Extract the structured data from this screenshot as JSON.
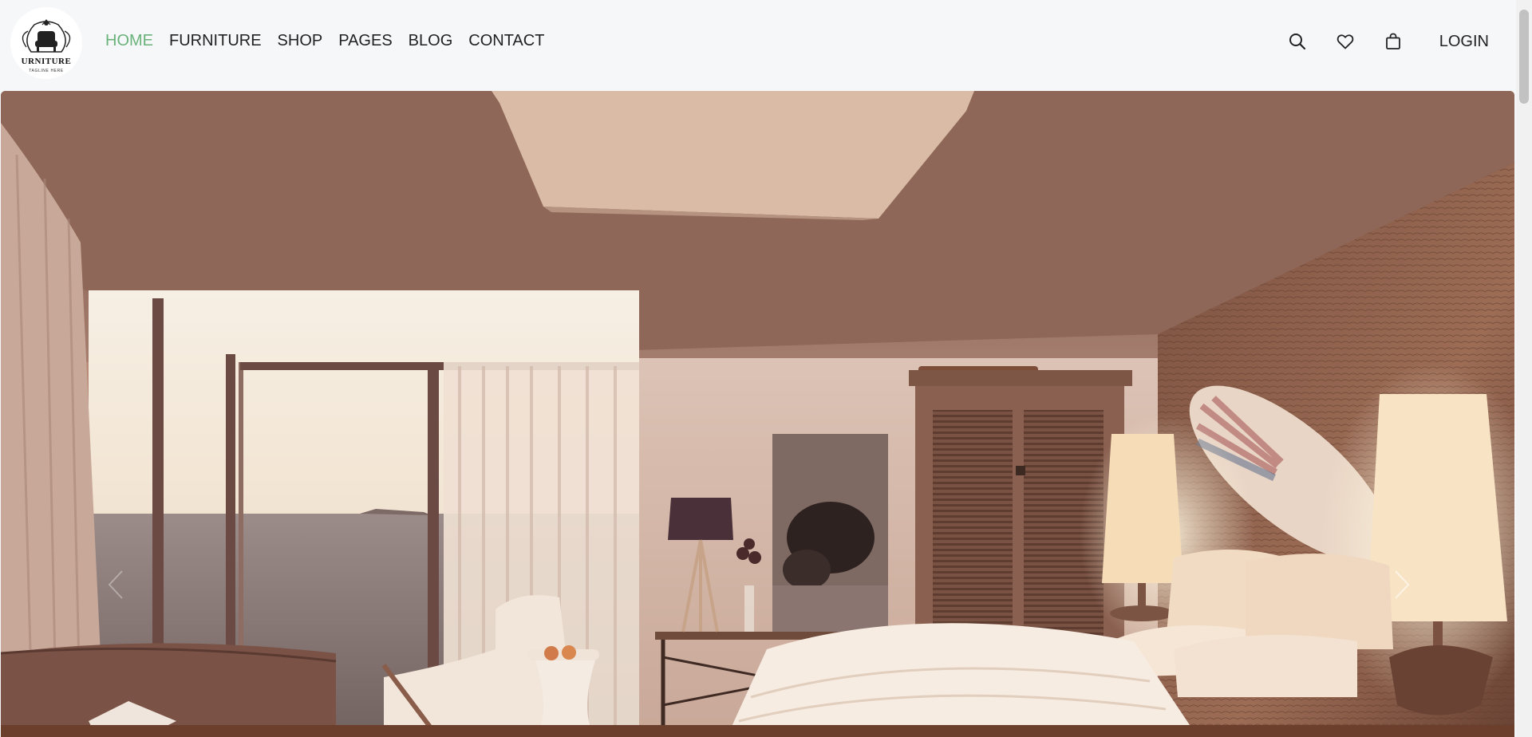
{
  "logo": {
    "text": "URNITURE",
    "tagline": "TAGLINE HERE"
  },
  "nav": {
    "items": [
      {
        "label": "HOME",
        "active": true
      },
      {
        "label": "FURNITURE",
        "active": false
      },
      {
        "label": "SHOP",
        "active": false
      },
      {
        "label": "PAGES",
        "active": false
      },
      {
        "label": "BLOG",
        "active": false
      },
      {
        "label": "CONTACT",
        "active": false
      }
    ]
  },
  "actions": {
    "search_icon": "search-icon",
    "wishlist_icon": "heart-icon",
    "cart_icon": "shopping-bag-icon",
    "login_label": "LOGIN"
  },
  "hero": {
    "image_subject": "bedroom-interior",
    "prev_icon": "chevron-left-icon",
    "next_icon": "chevron-right-icon"
  },
  "colors": {
    "accent": "#69b27a",
    "text": "#222222",
    "header_bg": "#f6f7f9"
  }
}
